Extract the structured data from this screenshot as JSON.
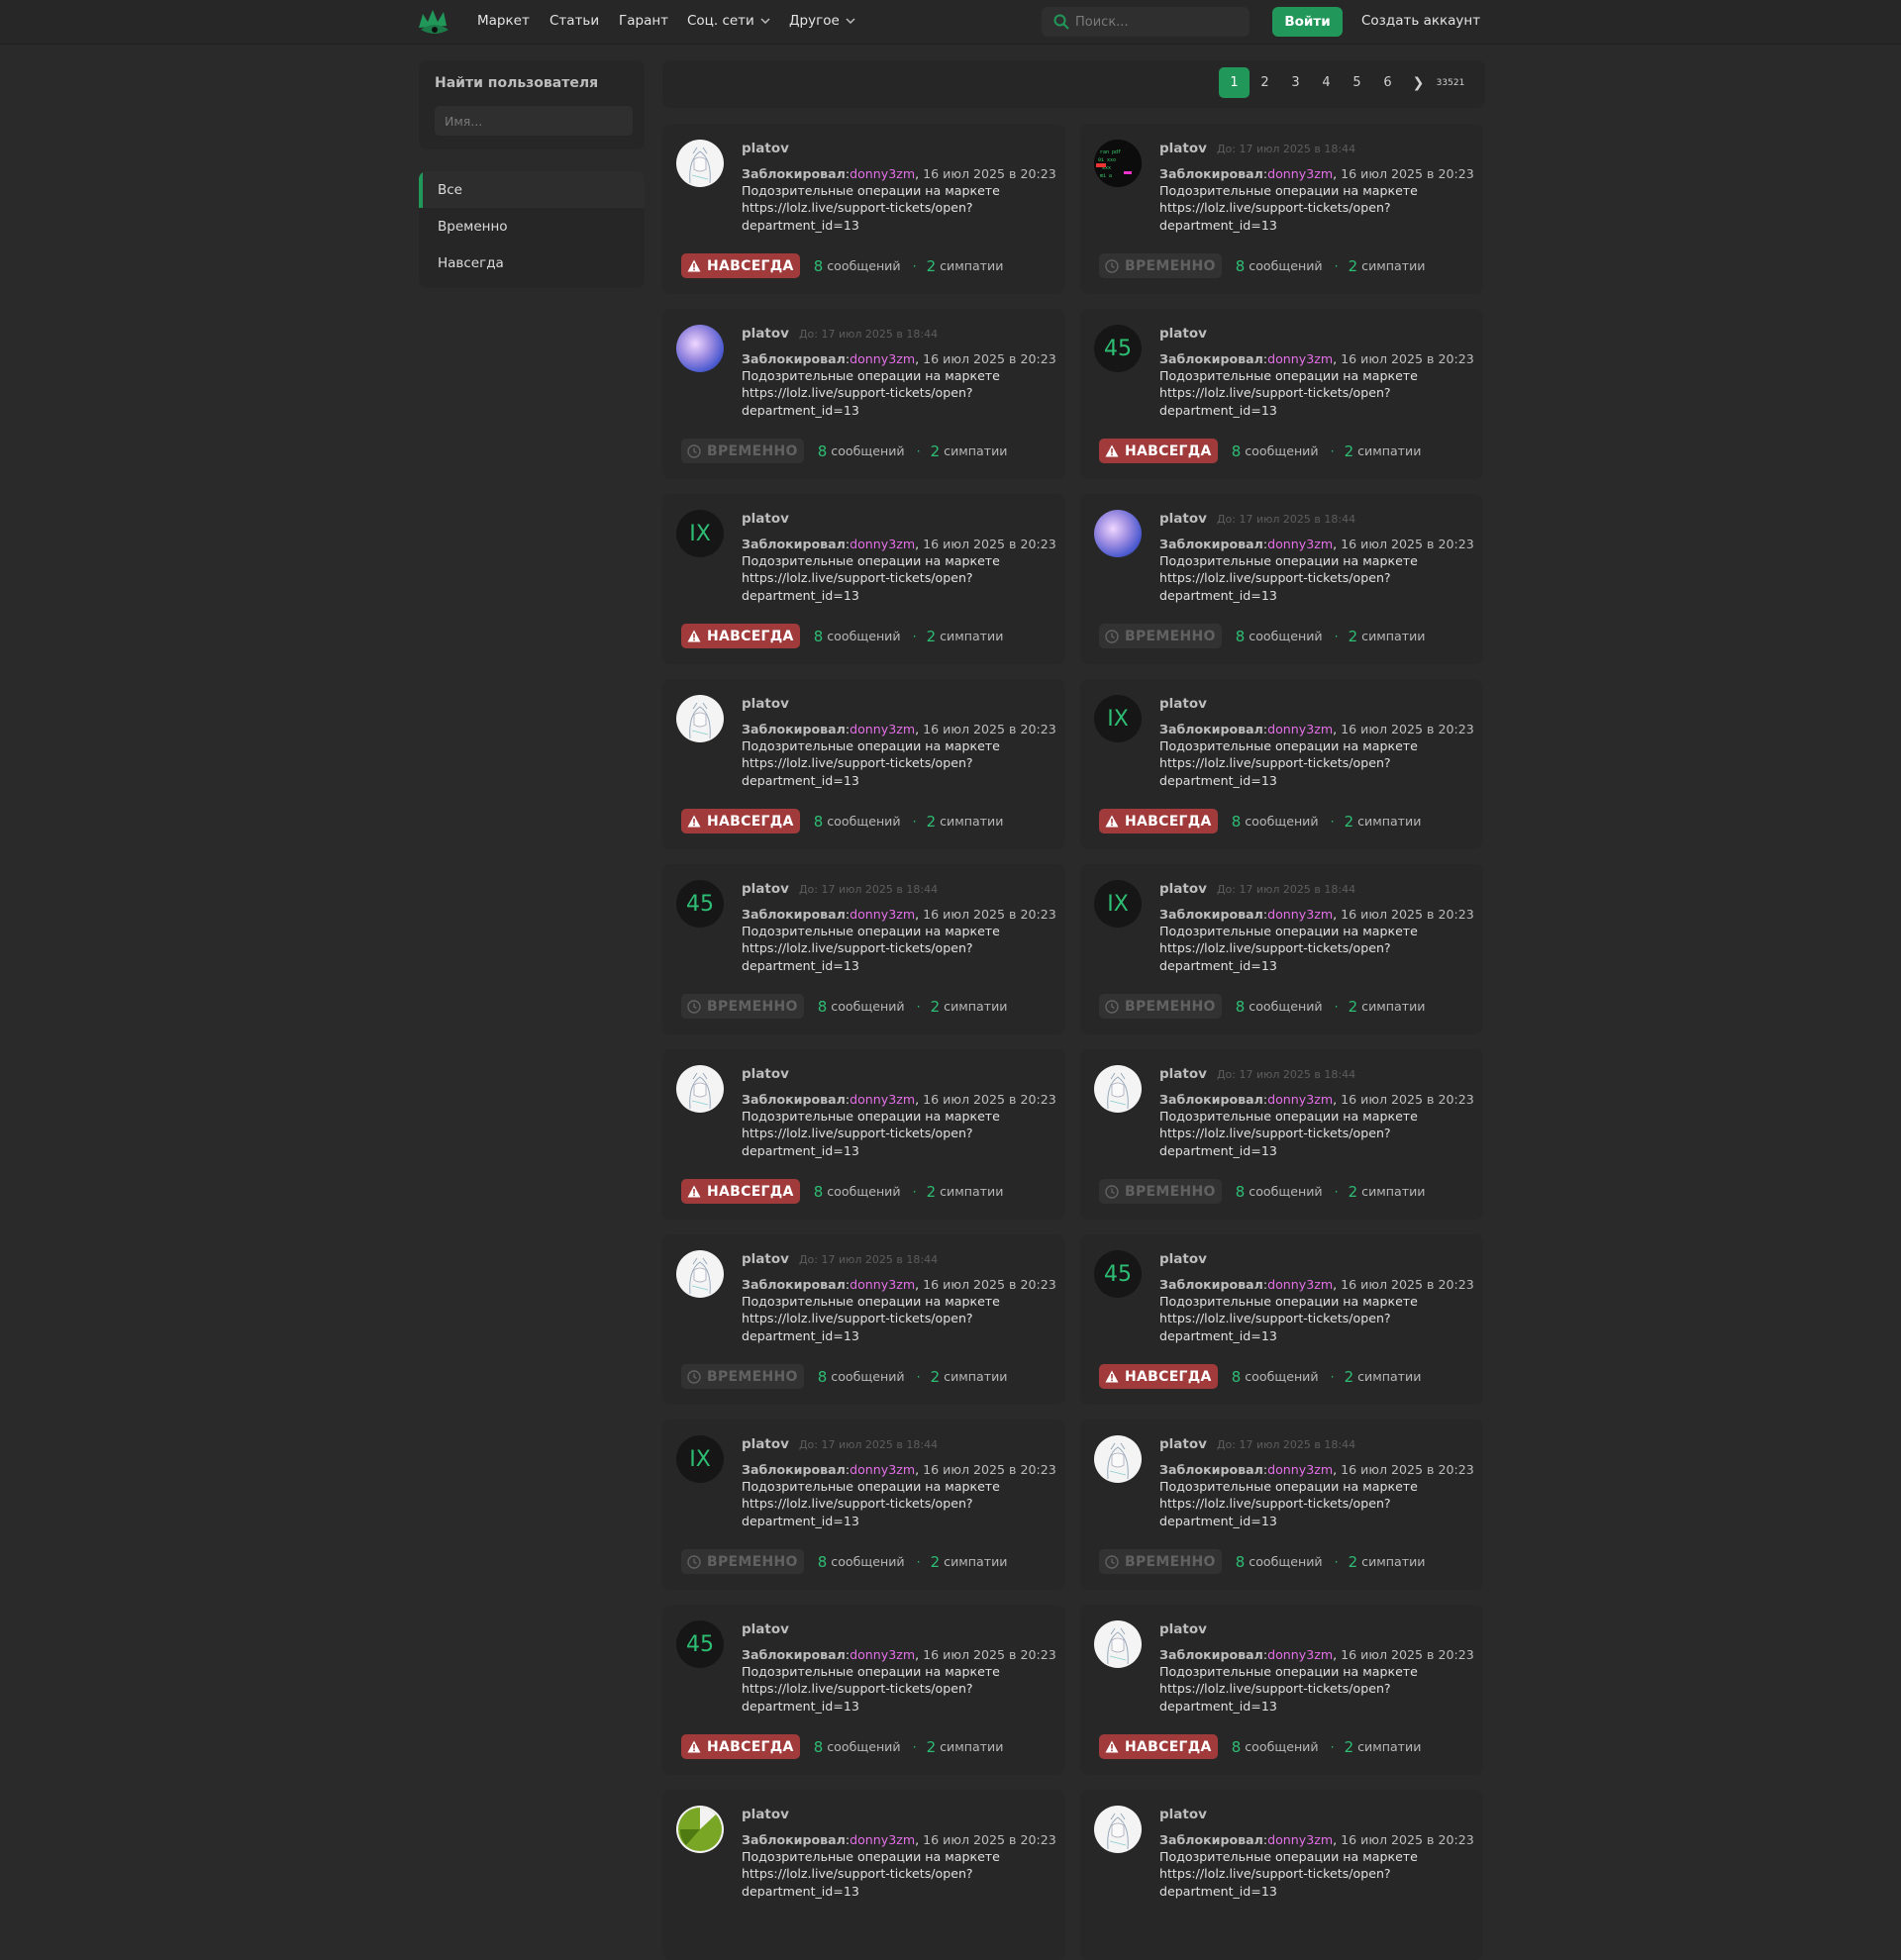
{
  "header": {
    "nav": [
      "Маркет",
      "Статьи",
      "Гарант",
      "Соц. сети",
      "Другое"
    ],
    "search_placeholder": "Поиск...",
    "login": "Войти",
    "signup": "Создать аккаунт"
  },
  "sidebar": {
    "finder_title": "Найти пользователя",
    "name_placeholder": "Имя...",
    "filters": [
      "Все",
      "Временно",
      "Навсегда"
    ]
  },
  "pagination": {
    "pages": [
      "1",
      "2",
      "3",
      "4",
      "5",
      "6"
    ],
    "next": "❯",
    "last": "33521"
  },
  "ban_template": {
    "username": "platov",
    "until": "До: 17 июл 2025 в 18:44",
    "blocked_label": "Заблокировал",
    "moderator": "donny3zm",
    "date": "16 июл 2025 в 20:23",
    "reason_line1": "Подозрительные операции на маркете",
    "reason_line2": "https://lolz.live/support-tickets/open?",
    "reason_line3": "department_id=13",
    "badge_forever": "НАВСЕГДА",
    "badge_temp": "ВРЕМЕННО",
    "messages_count": "8",
    "messages_label": "сообщений",
    "likes_count": "2",
    "likes_label": "симпатии",
    "sep": "·"
  },
  "bans": [
    {
      "avatar": "white",
      "type": "forever"
    },
    {
      "avatar": "matrix",
      "type": "temp"
    },
    {
      "avatar": "anime",
      "type": "temp"
    },
    {
      "avatar": "45",
      "type": "forever"
    },
    {
      "avatar": "IX",
      "type": "forever"
    },
    {
      "avatar": "anime",
      "type": "temp"
    },
    {
      "avatar": "white",
      "type": "forever"
    },
    {
      "avatar": "IX",
      "type": "forever"
    },
    {
      "avatar": "45",
      "type": "temp"
    },
    {
      "avatar": "IX",
      "type": "temp"
    },
    {
      "avatar": "white",
      "type": "forever"
    },
    {
      "avatar": "white",
      "type": "temp"
    },
    {
      "avatar": "white",
      "type": "temp"
    },
    {
      "avatar": "45",
      "type": "forever"
    },
    {
      "avatar": "IX",
      "type": "temp"
    },
    {
      "avatar": "white",
      "type": "temp"
    },
    {
      "avatar": "45",
      "type": "forever"
    },
    {
      "avatar": "white",
      "type": "forever"
    },
    {
      "avatar": "green",
      "type": "none"
    },
    {
      "avatar": "white",
      "type": "none"
    }
  ],
  "colors": {
    "accent": "#22975a",
    "forever_badge": "#a13b3b",
    "moderator": "#e36fe6"
  }
}
